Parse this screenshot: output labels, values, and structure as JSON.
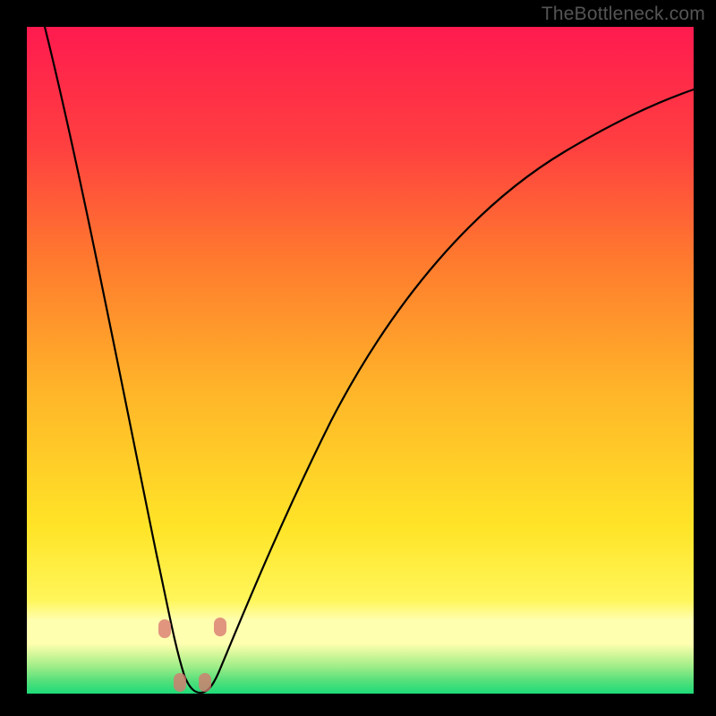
{
  "watermark": "TheBottleneck.com",
  "colors": {
    "top": "#ff1a4f",
    "mid_upper": "#ff6a2e",
    "mid": "#ffb629",
    "mid_lower": "#ffe427",
    "pale_band": "#ffffb0",
    "green_band_1": "#c7f787",
    "green_band_2": "#7be77a",
    "bottom": "#1edb78",
    "curve": "#000000",
    "marker": "#d8776f"
  },
  "chart_data": {
    "type": "line",
    "title": "",
    "xlabel": "",
    "ylabel": "",
    "xlim": [
      0,
      100
    ],
    "ylim": [
      0,
      100
    ],
    "x": [
      0,
      2,
      4,
      6,
      8,
      10,
      12,
      14,
      16,
      18,
      20,
      21,
      22,
      23,
      24,
      25,
      26,
      27,
      28,
      30,
      34,
      38,
      42,
      46,
      50,
      55,
      60,
      65,
      70,
      75,
      80,
      85,
      90,
      95,
      100
    ],
    "values": [
      100,
      92,
      84,
      76,
      68,
      60,
      52,
      44,
      36,
      28,
      16,
      9,
      4,
      1,
      0,
      0,
      1,
      3,
      6,
      12,
      23,
      33,
      42,
      49,
      55,
      61,
      66,
      70,
      73.5,
      76.5,
      79,
      81,
      82.8,
      84.2,
      85.3
    ],
    "markers": [
      {
        "x": 20.2,
        "y": 9.4
      },
      {
        "x": 22.1,
        "y": 1.2
      },
      {
        "x": 25.5,
        "y": 1.2
      },
      {
        "x": 27.5,
        "y": 9.2
      }
    ],
    "note": "Values estimated from pixel positions; chart has no axis ticks or labels. y=0 at bottom, y=100 at top. Curve depicts a deep V reaching bottom near x≈24 then rising with diminishing slope."
  }
}
